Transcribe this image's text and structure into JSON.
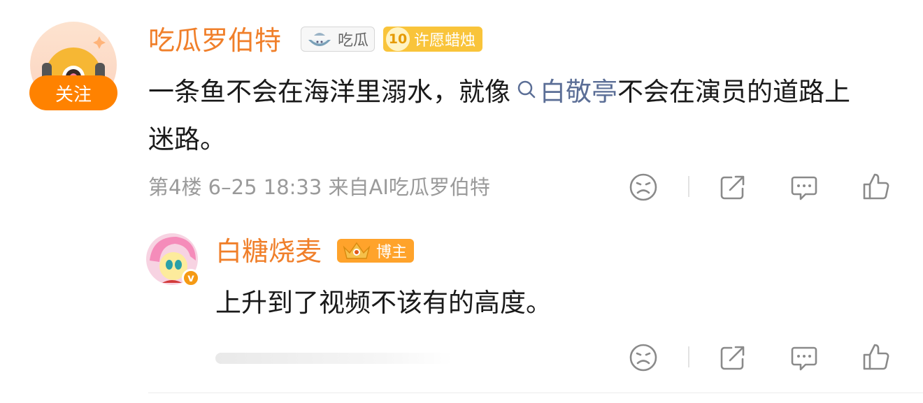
{
  "comment": {
    "username": "吃瓜罗伯特",
    "badge_chigua": "吃瓜",
    "badge_level": "10",
    "badge_wish": "许愿蜡烛",
    "follow_label": "关注",
    "text_part1": "一条鱼不会在海洋里溺水，就像",
    "topic": "白敬亭",
    "text_part2": "不会在演员的道路上迷路。",
    "meta": "第4楼  6–25 18:33  来自AI吃瓜罗伯特"
  },
  "reply": {
    "username": "白糖烧麦",
    "badge_blogger": "博主",
    "verified_mark": "v",
    "text": "上升到了视频不该有的高度。"
  },
  "colors": {
    "username": "#f07f2a",
    "link": "#5b6e96",
    "follow_button": "#ff8200",
    "badge_gold": "#f9c43a",
    "badge_orange": "#ffa32b"
  },
  "icons": [
    "sad-face-icon",
    "share-icon",
    "comment-icon",
    "like-icon"
  ]
}
